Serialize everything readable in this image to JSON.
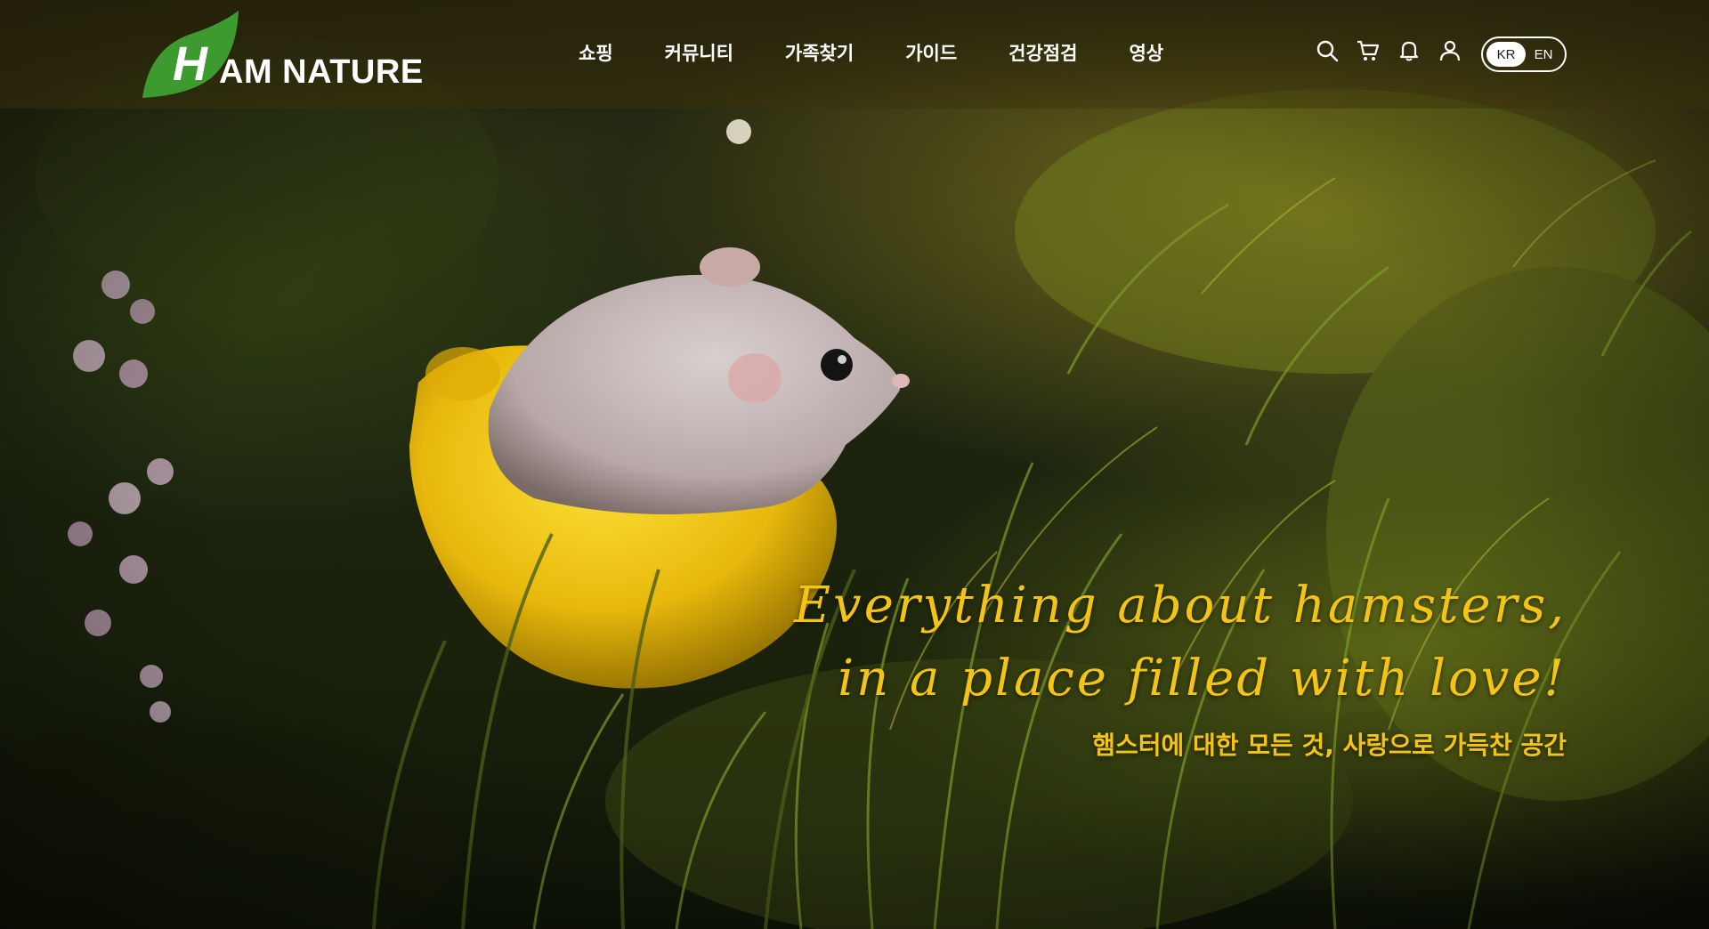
{
  "brand": {
    "logo_text": "AM NATURE",
    "logo_letter": "H",
    "accent_green": "#3d9a2e",
    "accent_yellow": "#f3c316"
  },
  "nav": {
    "items": [
      {
        "label": "쇼핑"
      },
      {
        "label": "커뮤니티"
      },
      {
        "label": "가족찾기"
      },
      {
        "label": "가이드"
      },
      {
        "label": "건강점검"
      },
      {
        "label": "영상"
      }
    ]
  },
  "icons": [
    "search-icon",
    "cart-icon",
    "bell-icon",
    "user-icon"
  ],
  "language": {
    "options": [
      "KR",
      "EN"
    ],
    "selected": "KR"
  },
  "hero": {
    "tagline_line1": "Everything about hamsters,",
    "tagline_line2": "in a place filled with love!",
    "tagline_ko": "햄스터에 대한 모든 것, 사랑으로 가득찬 공간"
  }
}
